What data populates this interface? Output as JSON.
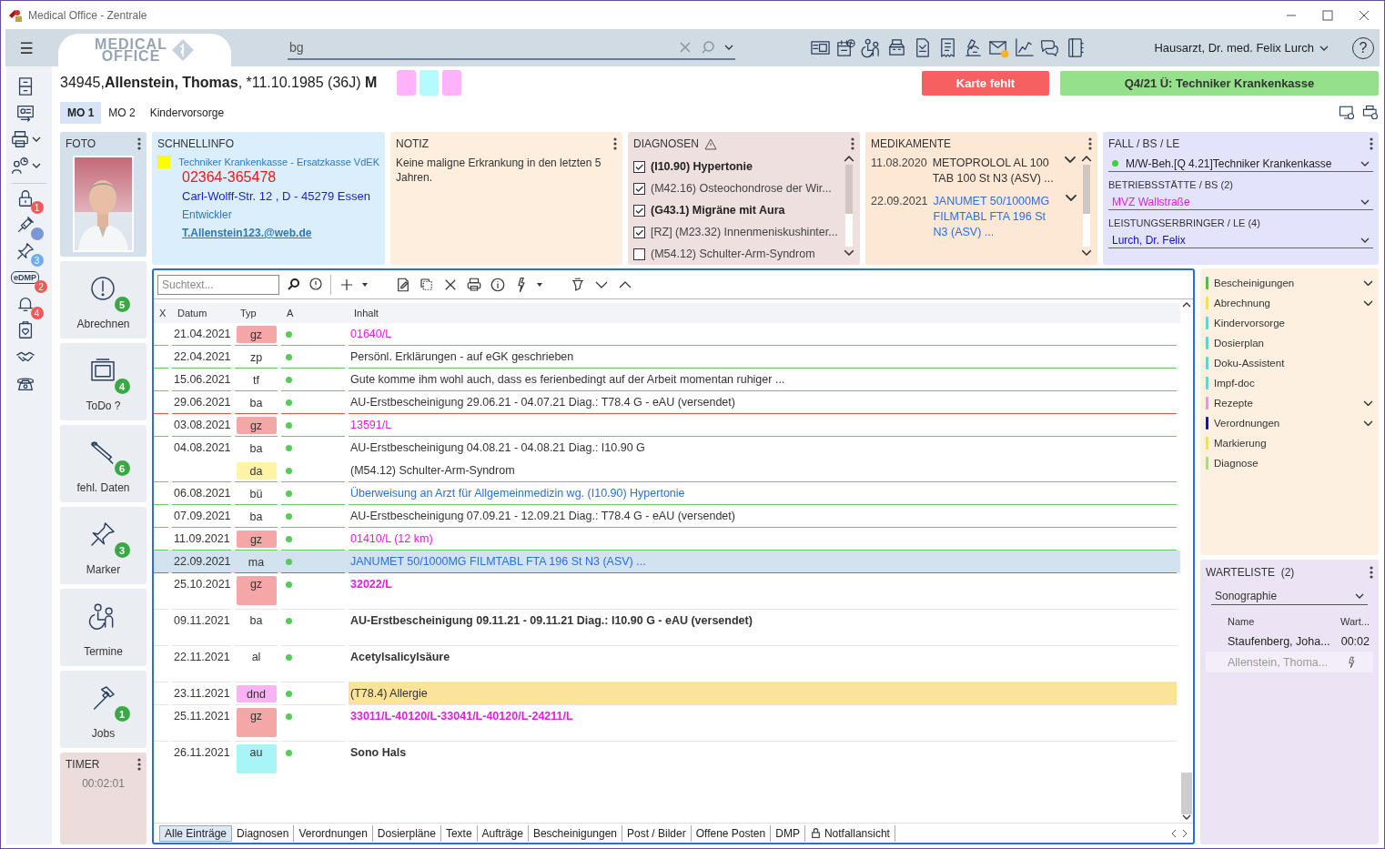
{
  "window": {
    "title": "Medical Office - Zentrale"
  },
  "topbar": {
    "menu": "☰",
    "logo": [
      "MEDICAL",
      "OFFICE"
    ],
    "search": {
      "value": "bg"
    },
    "tools": [
      {
        "kind": "id-card"
      },
      {
        "kind": "calendar"
      },
      {
        "kind": "people"
      },
      {
        "kind": "register"
      },
      {
        "kind": "document"
      },
      {
        "kind": "receipt"
      },
      {
        "kind": "microscope"
      },
      {
        "kind": "envelope"
      },
      {
        "kind": "chart"
      },
      {
        "kind": "chat"
      },
      {
        "kind": "notebook"
      }
    ],
    "user": "Hausarzt, Dr. med. Felix Lurch",
    "help": "?"
  },
  "sidebar": {
    "items": [
      {
        "kind": "cabinet",
        "has_menu": false
      },
      {
        "kind": "card",
        "has_menu": false
      },
      {
        "kind": "printer",
        "has_menu": true
      },
      {
        "kind": "person-clock",
        "has_menu": true
      },
      {
        "kind": "lock",
        "has_menu": false,
        "badge": {
          "text": "1",
          "color": "#f25a5a"
        }
      },
      {
        "kind": "syringe",
        "has_menu": false,
        "badge": {
          "color": "#7b98d6"
        }
      },
      {
        "kind": "pin",
        "has_menu": false,
        "badge": {
          "text": "3",
          "color": "#6aaef0"
        }
      },
      {
        "kind": "label",
        "label": "eDMP",
        "has_menu": false,
        "badge": {
          "text": "2",
          "color": "#f25a5a"
        }
      },
      {
        "kind": "bell",
        "has_menu": false,
        "badge": {
          "text": "4",
          "color": "#f25a5a"
        }
      },
      {
        "kind": "clipboard",
        "has_menu": false
      },
      {
        "kind": "hands",
        "has_menu": false
      },
      {
        "kind": "phone",
        "has_menu": false
      }
    ]
  },
  "patient": {
    "number": "34945,",
    "name": "Allenstein, Thomas",
    "details": ", *11.10.1985 (36J)",
    "sex": "M",
    "chips": [
      {
        "color": "#ffb3fb"
      },
      {
        "color": "#b3fbff"
      },
      {
        "color": "#ffb3fb"
      }
    ],
    "alert": "Karte fehlt",
    "insurance_status": "Q4/21 Ü: Techniker Krankenkasse"
  },
  "tabs": [
    {
      "label": "MO 1",
      "selected": true
    },
    {
      "label": "MO 2",
      "selected": false
    },
    {
      "label": "Kindervorsorge",
      "selected": false
    }
  ],
  "photo": {
    "title": "FOTO"
  },
  "quickinfo": {
    "title": "SCHNELLINFO",
    "marker": {
      "color": "#ffff00"
    },
    "insurance": "Techniker Krankenkasse - Ersatzkasse VdEK",
    "phone": "02364-365478",
    "address": "Carl-Wolff-Str. 12 , D - 45279 Essen",
    "occupation": "Entwickler",
    "email": "T.Allenstein123.@web.de"
  },
  "note": {
    "title": "NOTIZ",
    "text": "Keine maligne Erkrankung in den letzten 5 Jahren."
  },
  "diagnoses": {
    "title": "DIAGNOSEN",
    "items": [
      {
        "text": "(I10.90) Hypertonie",
        "checked": true,
        "bold": true
      },
      {
        "text": "(M42.16) Osteochondrose der Wir...",
        "checked": true,
        "bold": false
      },
      {
        "text": "(G43.1) Migräne mit Aura",
        "checked": true,
        "bold": true
      },
      {
        "text": "[RZ] (M23.32) Innenmeniskushinter...",
        "checked": true,
        "bold": false
      },
      {
        "text": "(M54.12) Schulter-Arm-Syndrom",
        "checked": false,
        "bold": false
      }
    ]
  },
  "medications": {
    "title": "MEDIKAMENTE",
    "items": [
      {
        "date": "11.08.2020",
        "text": "METOPROLOL AL 100 TAB 100 St N3 (ASV) ...",
        "color": "#333333"
      },
      {
        "date": "22.09.2021",
        "text": "JANUMET 50/1000MG FILMTABL FTA 196 St N3 (ASV) ...",
        "color": "#2b6fe0"
      }
    ]
  },
  "case": {
    "title": "FALL / BS / LE",
    "fields": [
      {
        "value": "M/W-Beh.[Q 4.21]Techniker Krankenkasse",
        "color": "#222222",
        "dot": {
          "color": "#44cc44"
        }
      },
      {
        "label": "BETRIEBSSTÄTTE / BS (2)",
        "value": "MVZ Wallstraße",
        "color": "#e020e0"
      },
      {
        "label": "LEISTUNGSERBRINGER / LE (4)",
        "value": "Lurch, Dr. Felix",
        "color": "#1010d0"
      }
    ]
  },
  "tiles": [
    {
      "kind": "alert",
      "label": "Abrechnen",
      "badge": "5"
    },
    {
      "kind": "board",
      "label": "ToDo ?",
      "badge": "4"
    },
    {
      "kind": "tube",
      "label": "fehl. Daten",
      "badge": "6"
    },
    {
      "kind": "pin",
      "label": "Marker",
      "badge": "3"
    },
    {
      "kind": "people",
      "label": "Termine"
    },
    {
      "kind": "hammer",
      "label": "Jobs",
      "badge": "1"
    }
  ],
  "timer": {
    "title": "TIMER",
    "time": "00:02:01"
  },
  "journal": {
    "search_placeholder": "Suchtext...",
    "columns": [
      "X",
      "Datum",
      "Typ",
      "A",
      "Inhalt"
    ],
    "rows": [
      {
        "date": "21.04.2021",
        "type": {
          "text": "gz",
          "color": "#f5a7a7"
        },
        "status": {
          "color": "#55cc55"
        },
        "content": {
          "text": "01640/L",
          "color": "#e020e0"
        },
        "bold": false,
        "selected": false,
        "highlight": false,
        "line": {
          "color": "#66cc66"
        }
      },
      {
        "date": "22.04.2021",
        "type": {
          "text": "zp"
        },
        "status": {
          "color": "#55cc55"
        },
        "content": {
          "text": "Persönl. Erklärungen - auf eGK geschrieben",
          "color": "#333333"
        },
        "bold": false,
        "selected": false,
        "highlight": false,
        "line": {
          "color": "#66cc66"
        }
      },
      {
        "date": "15.06.2021",
        "type": {
          "text": "tf"
        },
        "status": {
          "color": "#55cc55"
        },
        "content": {
          "text": "Gute komme ihm wohl auch, dass es ferienbedingt auf der Arbeit momentan ruhiger ...",
          "color": "#333333"
        },
        "bold": false,
        "selected": false,
        "highlight": false,
        "line": {
          "color": "#66cc66"
        }
      },
      {
        "date": "29.06.2021",
        "type": {
          "text": "ba"
        },
        "status": {
          "color": "#55cc55"
        },
        "content": {
          "text": "AU-Erstbescheinigung 29.06.21 - 04.07.21 Diag.: T78.4 G - eAU (versendet)",
          "color": "#333333"
        },
        "bold": false,
        "selected": false,
        "highlight": false,
        "line": {
          "color": "#f05050"
        }
      },
      {
        "date": "03.08.2021",
        "type": {
          "text": "gz",
          "color": "#f5a7a7"
        },
        "status": {
          "color": "#55cc55"
        },
        "content": {
          "text": "13591/L",
          "color": "#e020e0"
        },
        "bold": false,
        "selected": false,
        "highlight": false,
        "line": {
          "color": "#66cc66"
        }
      },
      {
        "date": "04.08.2021",
        "type": {
          "text": "ba"
        },
        "status": {
          "color": "#55cc55"
        },
        "content": {
          "text": "AU-Erstbescheinigung 04.08.21 - 04.08.21 Diag.: I10.90 G",
          "color": "#333333"
        },
        "bold": false,
        "selected": false,
        "highlight": false
      },
      {
        "type": {
          "text": "da",
          "color": "#fff3a8"
        },
        "status": {
          "color": "#55cc55"
        },
        "content": {
          "text": "(M54.12) Schulter-Arm-Syndrom",
          "color": "#333333"
        },
        "bold": false,
        "selected": false,
        "highlight": false,
        "line": {
          "color": "#66cc66"
        }
      },
      {
        "date": "06.08.2021",
        "type": {
          "text": "bü"
        },
        "status": {
          "color": "#55cc55"
        },
        "content": {
          "text": "Überweisung an Arzt für Allgemeinmedizin wg. (I10.90) Hypertonie",
          "color": "#2b6fe0"
        },
        "bold": false,
        "selected": false,
        "highlight": false,
        "line": {
          "color": "#66cc66"
        }
      },
      {
        "date": "07.09.2021",
        "type": {
          "text": "ba"
        },
        "status": {
          "color": "#55cc55"
        },
        "content": {
          "text": "AU-Erstbescheinigung 07.09.21 - 12.09.21 Diag.: T78.4 G - eAU (versendet)",
          "color": "#333333"
        },
        "bold": false,
        "selected": false,
        "highlight": false,
        "line": {
          "color": "#66cc66"
        }
      },
      {
        "date": "11.09.2021",
        "type": {
          "text": "gz",
          "color": "#f5a7a7"
        },
        "status": {
          "color": "#55cc55"
        },
        "content": {
          "text": "01410/L (12 km)",
          "color": "#e020e0"
        },
        "bold": false,
        "selected": false,
        "highlight": false,
        "line": {
          "color": "#66cc66"
        }
      },
      {
        "date": "22.09.2021",
        "type": {
          "text": "ma"
        },
        "status": {
          "color": "#55cc55"
        },
        "content": {
          "text": "JANUMET 50/1000MG FILMTABL FTA 196 St N3 (ASV) ...",
          "color": "#2b6fe0"
        },
        "bold": false,
        "selected": true,
        "highlight": false,
        "line": {
          "color": "#f05050"
        }
      },
      {
        "date": "25.10.2021",
        "type": {
          "text": "gz",
          "color": "#f5a7a7"
        },
        "status": {
          "color": "#55cc55"
        },
        "content": {
          "text": "32022/L",
          "color": "#e020e0"
        },
        "bold": true,
        "selected": false,
        "highlight": false,
        "line": {
          "color": "#e2e6ec"
        }
      },
      {
        "date": "09.11.2021",
        "type": {
          "text": "ba"
        },
        "status": {
          "color": "#55cc55"
        },
        "content": {
          "text": "AU-Erstbescheinigung 09.11.21 - 09.11.21 Diag.: I10.90 G - eAU (versendet)",
          "color": "#333333"
        },
        "bold": true,
        "selected": false,
        "highlight": false,
        "line": {
          "color": "#e2e6ec"
        }
      },
      {
        "date": "22.11.2021",
        "type": {
          "text": "al"
        },
        "status": {
          "color": "#55cc55"
        },
        "content": {
          "text": "Acetylsalicylsäure",
          "color": "#333333"
        },
        "bold": true,
        "selected": false,
        "highlight": false,
        "line": {
          "color": "#e2e6ec"
        }
      },
      {
        "date": "23.11.2021",
        "type": {
          "text": "dnd",
          "color": "#f7b3f3"
        },
        "status": {
          "color": "#55cc55"
        },
        "content": {
          "text": "(T78.4) Allergie",
          "color": "#333333"
        },
        "bold": false,
        "selected": false,
        "highlight": true,
        "line": {
          "color": "#e2e6ec"
        }
      },
      {
        "date": "25.11.2021",
        "type": {
          "text": "gz",
          "color": "#f5a7a7"
        },
        "status": {
          "color": "#55cc55"
        },
        "content": {
          "text": "33011/L-40120/L-33041/L-40120/L-24211/L",
          "color": "#e020e0"
        },
        "bold": true,
        "selected": false,
        "highlight": false,
        "line": {
          "color": "#e2e6ec"
        }
      },
      {
        "date": "26.11.2021",
        "type": {
          "text": "au",
          "color": "#a8f5f5"
        },
        "status": {
          "color": "#55cc55"
        },
        "content": {
          "text": "Sono Hals",
          "color": "#333333"
        },
        "bold": true,
        "selected": false,
        "highlight": false
      }
    ],
    "tabs": [
      {
        "label": "Alle Einträge",
        "selected": true
      },
      {
        "label": "Diagnosen",
        "selected": false
      },
      {
        "label": "Verordnungen",
        "selected": false
      },
      {
        "label": "Dosierpläne",
        "selected": false
      },
      {
        "label": "Texte",
        "selected": false
      },
      {
        "label": "Aufträge",
        "selected": false
      },
      {
        "label": "Bescheinigungen",
        "selected": false
      },
      {
        "label": "Post / Bilder",
        "selected": false
      },
      {
        "label": "Offene Posten",
        "selected": false
      },
      {
        "label": "DMP",
        "selected": false
      },
      {
        "label": "Notfallansicht",
        "selected": false,
        "locked": true
      }
    ]
  },
  "sidelist": {
    "items": [
      {
        "label": "Bescheinigungen",
        "color": "#22dd22",
        "expandable": true
      },
      {
        "label": "Abrechnung",
        "color": "#f0f000",
        "expandable": true
      },
      {
        "label": "Kindervorsorge",
        "color": "#22eeee",
        "expandable": false
      },
      {
        "label": "Dosierplan",
        "color": "#22eeee",
        "expandable": false
      },
      {
        "label": "Doku-Assistent",
        "color": "#22eeee",
        "expandable": false
      },
      {
        "label": "Impf-doc",
        "color": "#22eeee",
        "expandable": false
      },
      {
        "label": "Rezepte",
        "color": "#ff88f0",
        "expandable": true
      },
      {
        "label": "Verordnungen",
        "color": "#1010dd",
        "expandable": true
      },
      {
        "label": "Markierung",
        "color": "#f0f000",
        "expandable": false
      },
      {
        "label": "Diagnose",
        "color": "#99ee55",
        "expandable": false
      }
    ]
  },
  "waitlist": {
    "title": "WARTELISTE",
    "count": "(2)",
    "room": "Sonographie",
    "columns": [
      "Name",
      "Wart..."
    ],
    "rows": [
      {
        "name": "Staufenberg, Joha...",
        "kind": "time",
        "wait": "00:02",
        "greyed": false
      },
      {
        "name": "Allenstein, Thoma...",
        "kind": "called",
        "greyed": true
      }
    ]
  }
}
